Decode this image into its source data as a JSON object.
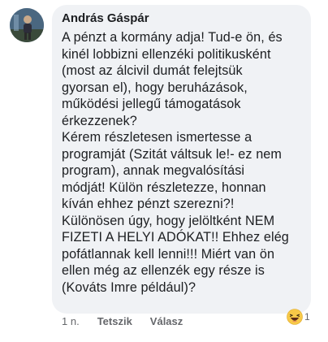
{
  "comment": {
    "author": "András Gáspár",
    "text": "A pénzt a kormány adja! Tud-e ön, és\nkinél lobbizni ellenzéki politikusként\n(most az álcivil dumát felejtsük\ngyorsan el), hogy beruházások,\nműködési jellegű támogatások\nérkezzenek?\nKérem részletesen ismertesse a\nprogramját (Szitát váltsuk le!- ez nem\nprogram), annak megvalósítási\nmódját! Külön részletezze, honnan\nkíván ehhez pénzt szerezni?!\nKülönösen úgy, hogy jelöltként NEM\nFIZETI A HELYI ADÓKAT!! Ehhez elég\npofátlannak kell lenni!!! Miért van ön\nellen még az ellenzék egy része is\n(Kováts Imre például)?",
    "time": "1 n.",
    "like_label": "Tetszik",
    "reply_label": "Válasz",
    "reaction": {
      "icon": "haha-emoji-icon",
      "count": "1"
    }
  },
  "colors": {
    "bubble_bg": "#f0f2f5",
    "text": "#1c1e21",
    "meta": "#65676b"
  }
}
